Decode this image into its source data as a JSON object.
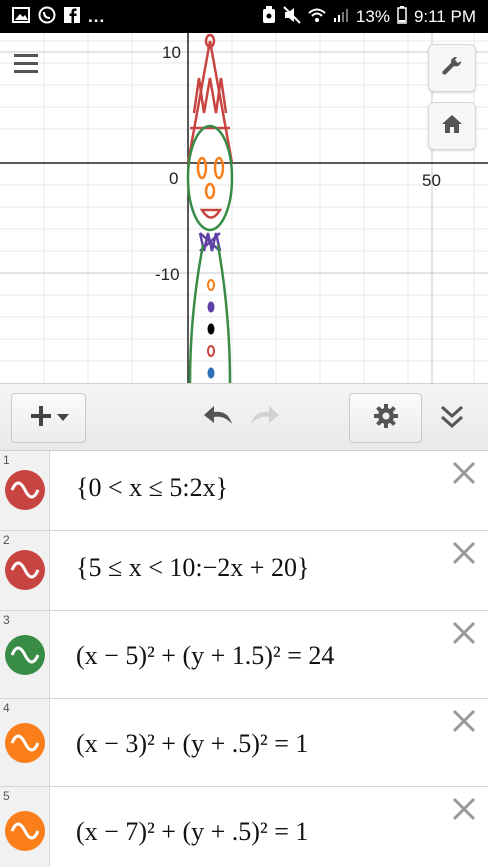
{
  "status_bar": {
    "overflow_dots": "...",
    "battery_percent": "13%",
    "time": "9:11 PM",
    "left_icons": [
      "gallery-icon",
      "whatsapp-icon",
      "facebook-icon"
    ],
    "right_icons": [
      "battery-saver-icon",
      "mute-icon",
      "wifi-icon",
      "signal-icon",
      "battery-icon"
    ]
  },
  "graph": {
    "x_ticks": [
      "0",
      "50"
    ],
    "y_ticks": [
      "10",
      "-10"
    ],
    "colors": {
      "red": "#c74440",
      "green": "#388c46",
      "orange": "#fa7e19",
      "purple": "#6042a6",
      "blue": "#2d70b3",
      "black": "#000000"
    }
  },
  "toolbar": {
    "icons": [
      "plus-icon",
      "caret-down-icon",
      "undo-icon",
      "redo-icon",
      "gear-icon",
      "double-chevron-down-icon"
    ]
  },
  "expressions": [
    {
      "index": "1",
      "color": "#c74440",
      "text": "{0 < x ≤ 5:2x}"
    },
    {
      "index": "2",
      "color": "#c74440",
      "text": "{5 ≤ x < 10:−2x + 20}"
    },
    {
      "index": "3",
      "color": "#388c46",
      "text": "(x − 5)² + (y + 1.5)² = 24"
    },
    {
      "index": "4",
      "color": "#fa7e19",
      "text": "(x − 3)² + (y + .5)² = 1"
    },
    {
      "index": "5",
      "color": "#fa7e19",
      "text": "(x − 7)² + (y + .5)² = 1"
    }
  ]
}
